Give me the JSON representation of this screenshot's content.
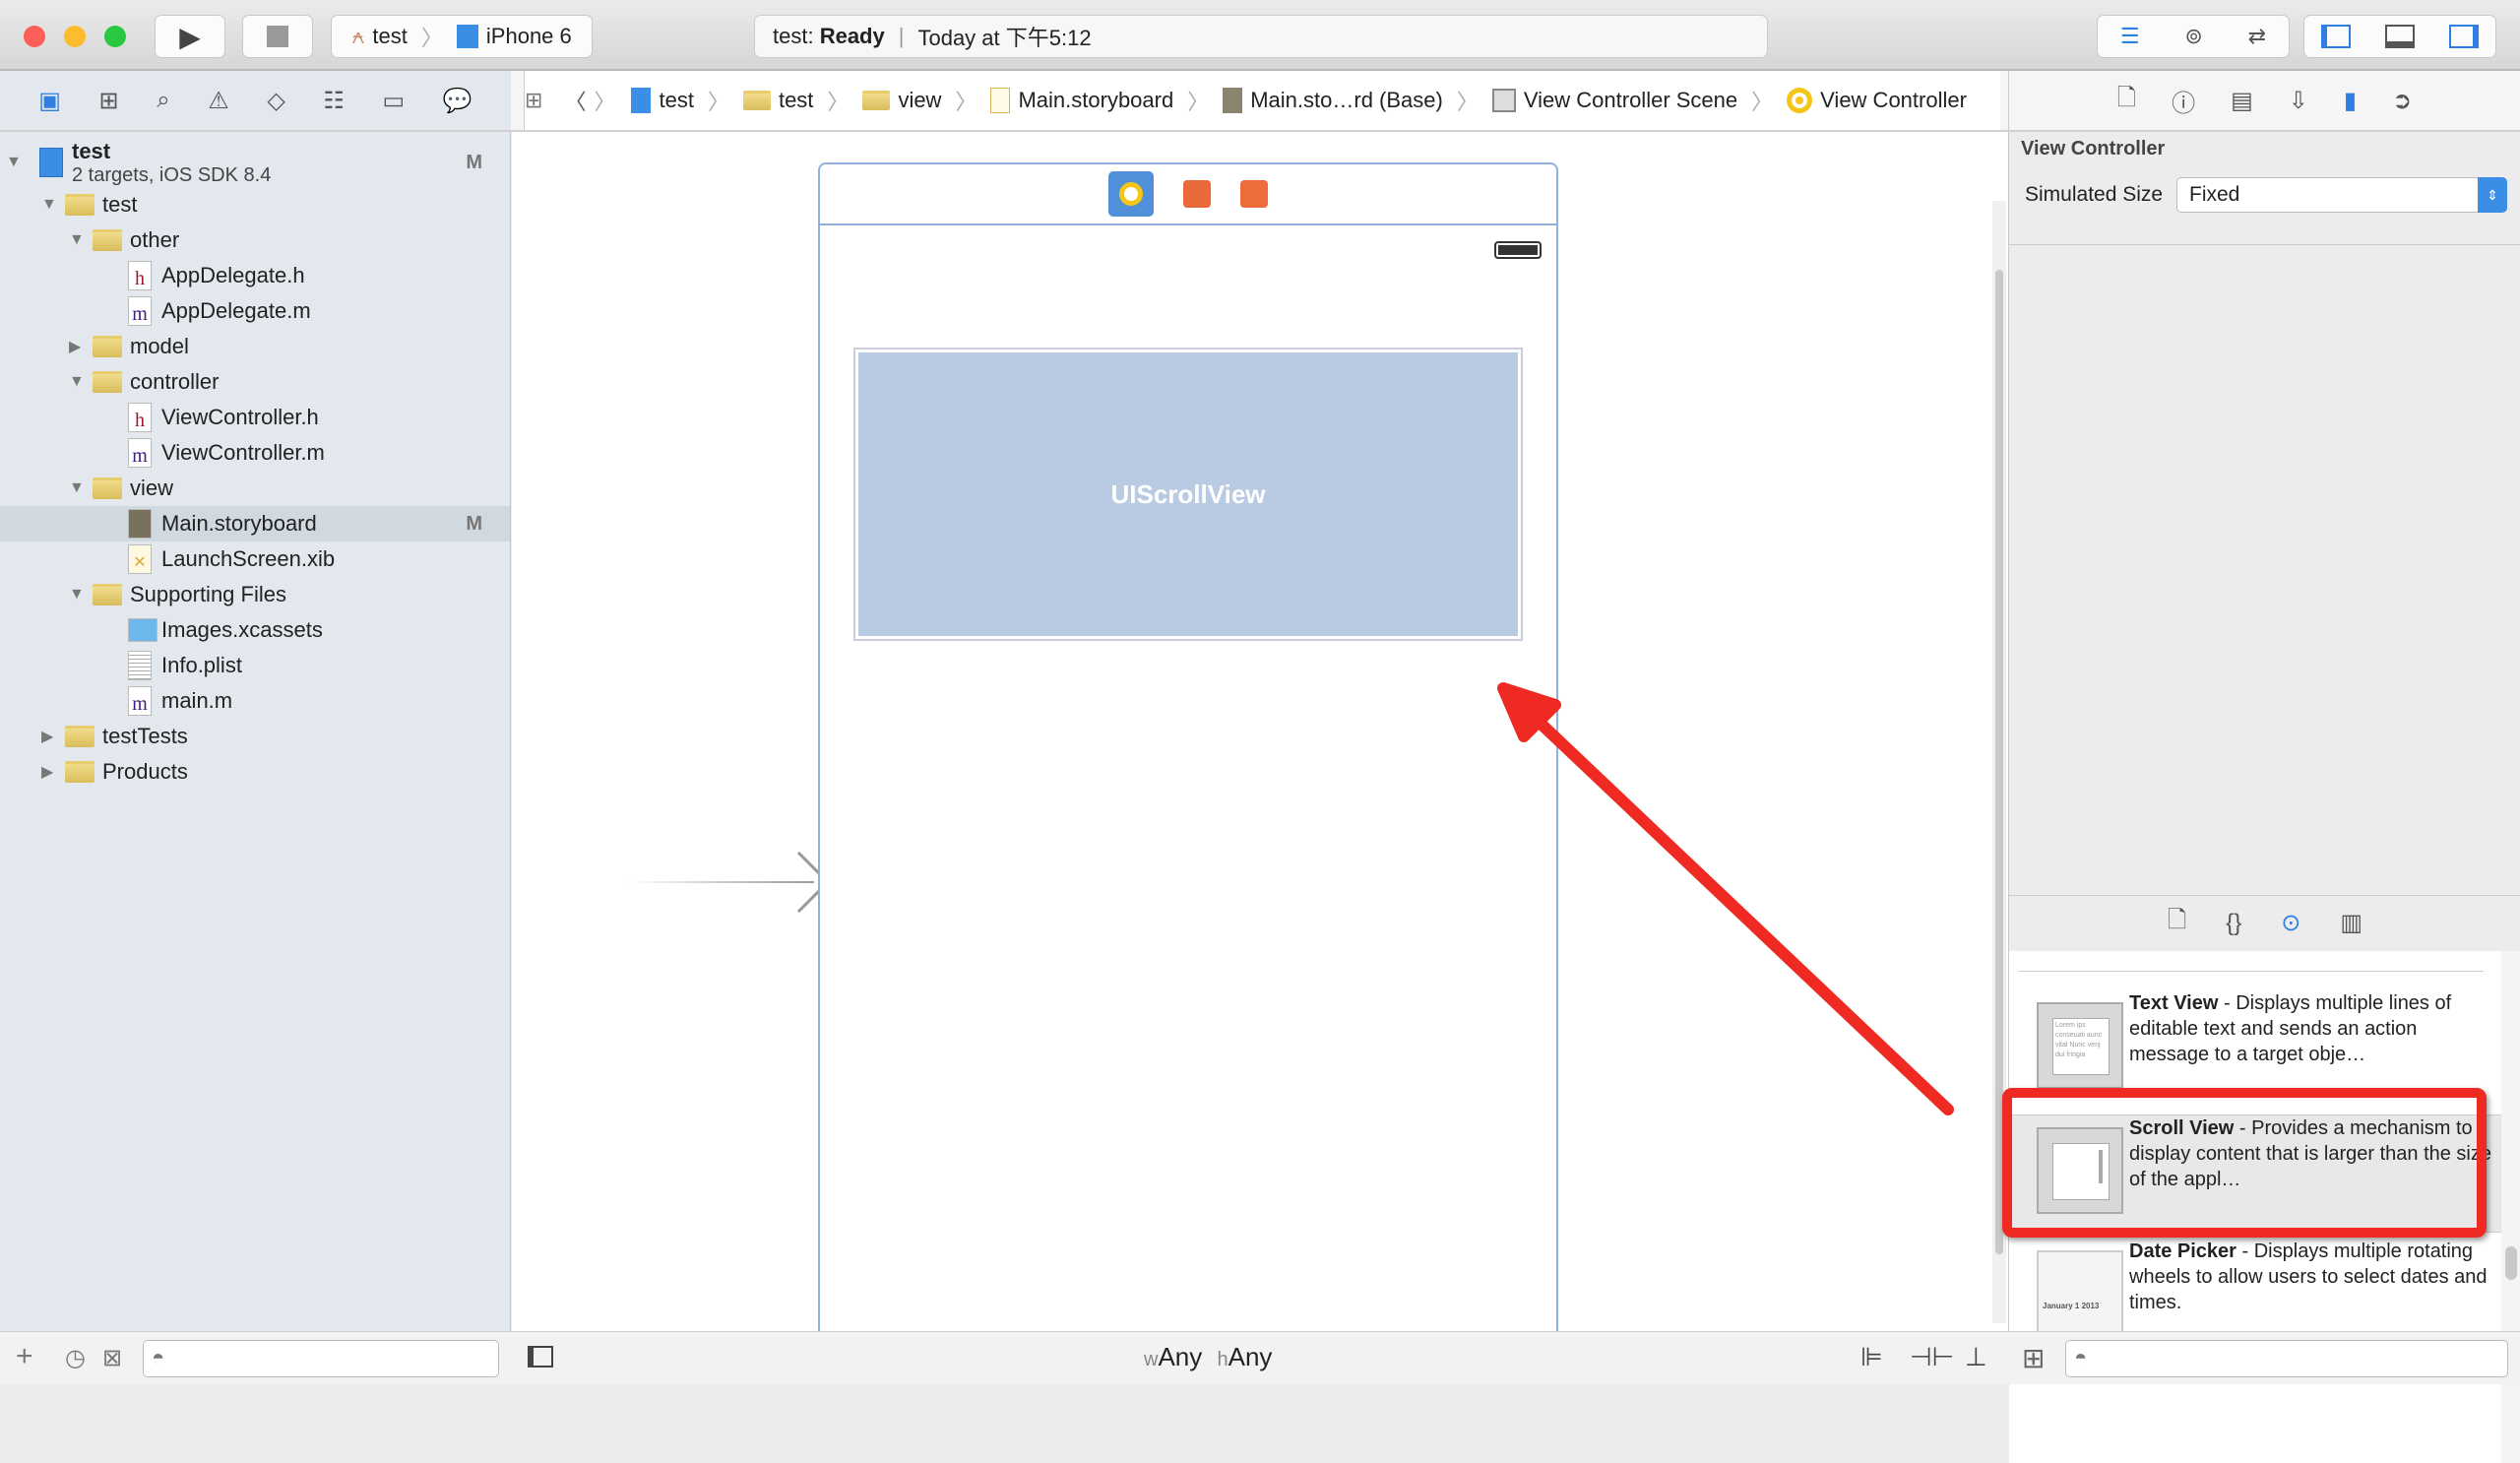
{
  "window": {
    "scheme": "test",
    "device": "iPhone 6",
    "status_project": "test:",
    "status_state": "Ready",
    "status_time": "Today at 下午5:12"
  },
  "breadcrumb": [
    "test",
    "test",
    "view",
    "Main.storyboard",
    "Main.sto…rd (Base)",
    "View Controller Scene",
    "View Controller"
  ],
  "navigator": {
    "tree": [
      {
        "label": "test",
        "sub": "2 targets, iOS SDK 8.4",
        "level": 0,
        "kind": "project",
        "open": true,
        "badge": "M"
      },
      {
        "label": "test",
        "level": 1,
        "kind": "folder",
        "open": true
      },
      {
        "label": "other",
        "level": 2,
        "kind": "folder",
        "open": true
      },
      {
        "label": "AppDelegate.h",
        "level": 3,
        "kind": "h"
      },
      {
        "label": "AppDelegate.m",
        "level": 3,
        "kind": "m"
      },
      {
        "label": "model",
        "level": 2,
        "kind": "folder",
        "open": false
      },
      {
        "label": "controller",
        "level": 2,
        "kind": "folder",
        "open": true
      },
      {
        "label": "ViewController.h",
        "level": 3,
        "kind": "h"
      },
      {
        "label": "ViewController.m",
        "level": 3,
        "kind": "m"
      },
      {
        "label": "view",
        "level": 2,
        "kind": "folder",
        "open": true
      },
      {
        "label": "Main.storyboard",
        "level": 3,
        "kind": "storyboard",
        "selected": true,
        "badge": "M"
      },
      {
        "label": "LaunchScreen.xib",
        "level": 3,
        "kind": "xib"
      },
      {
        "label": "Supporting Files",
        "level": 2,
        "kind": "folder",
        "open": true
      },
      {
        "label": "Images.xcassets",
        "level": 3,
        "kind": "xcassets"
      },
      {
        "label": "Info.plist",
        "level": 3,
        "kind": "plist"
      },
      {
        "label": "main.m",
        "level": 3,
        "kind": "m"
      },
      {
        "label": "testTests",
        "level": 1,
        "kind": "folder",
        "open": false
      },
      {
        "label": "Products",
        "level": 1,
        "kind": "folder",
        "open": false
      }
    ]
  },
  "canvas": {
    "scroll_view_label": "UIScrollView",
    "size_w_prefix": "w",
    "size_w": "Any",
    "size_h_prefix": "h",
    "size_h": "Any"
  },
  "inspector": {
    "section": "View Controller",
    "simulated_size_label": "Simulated Size",
    "simulated_size_value": "Fixed"
  },
  "library": [
    {
      "title": "Text View",
      "desc": " - Displays multiple lines of editable text and sends an action message to a target obje…",
      "thumb_text": "Lorem ips conseuati aunc vital Nunc venj dui fringia"
    },
    {
      "title": "Scroll View",
      "desc": " - Provides a mechanism to display content that is larger than the size of the appl…",
      "highlighted": true
    },
    {
      "title": "Date Picker",
      "desc": " - Displays multiple rotating wheels to allow users to select dates and times.",
      "thumb_text": "January 1 2013"
    }
  ],
  "colors": {
    "accent": "#2f7fe0",
    "annotation": "#ee2a22",
    "scroll_view_fill": "#b9cbe2"
  }
}
